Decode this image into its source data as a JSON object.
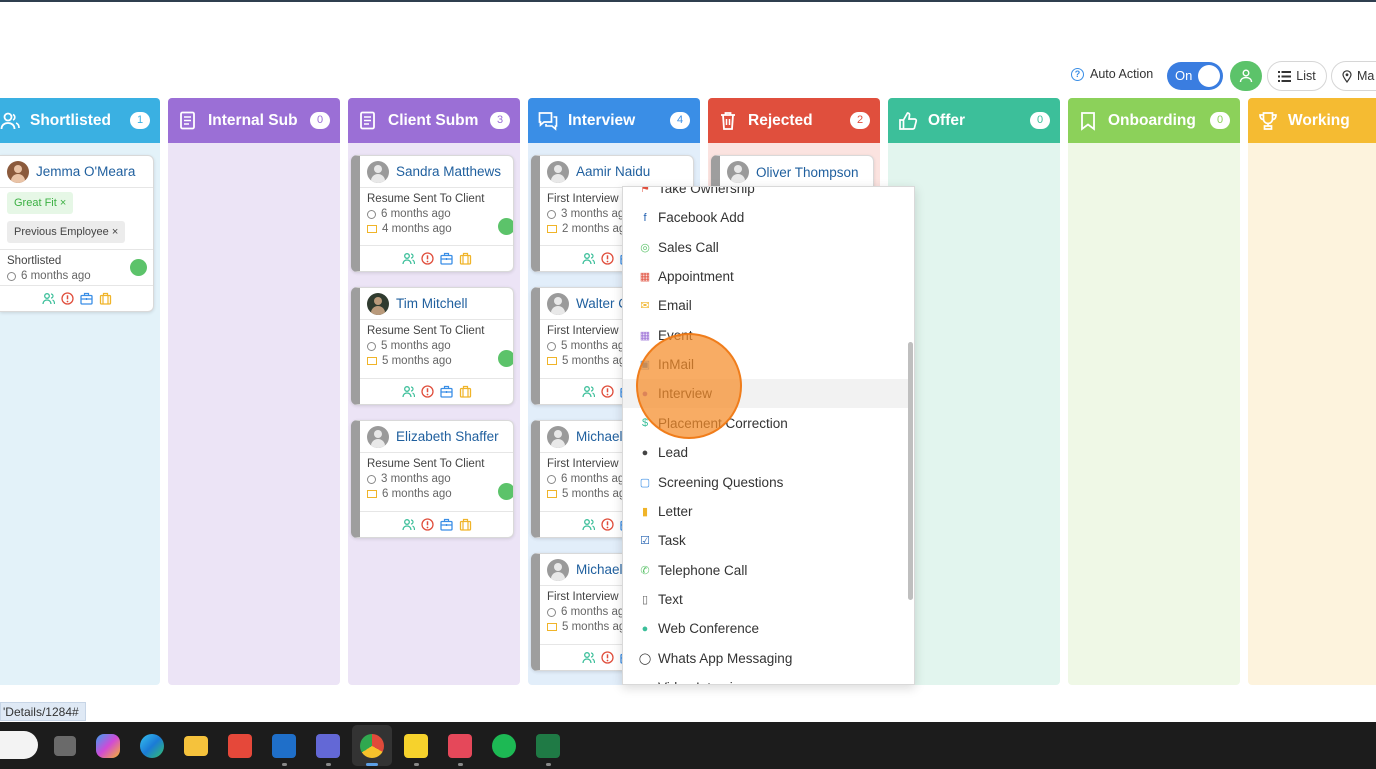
{
  "toolbar": {
    "auto_action_label": "Auto Action",
    "toggle_label": "On",
    "list_label": "List",
    "map_label": "Ma"
  },
  "columns": [
    {
      "title": "Shortlisted",
      "count": "1",
      "color": "#3ab0e2",
      "bg": "#e3f2f9",
      "icon": "users-icon"
    },
    {
      "title": "Internal Sub",
      "count": "0",
      "color": "#9b6fd6",
      "bg": "#ece4f6",
      "icon": "document-icon"
    },
    {
      "title": "Client Subm",
      "count": "3",
      "color": "#9b6fd6",
      "bg": "#ece4f6",
      "icon": "document-icon"
    },
    {
      "title": "Interview",
      "count": "4",
      "color": "#3a8ee6",
      "bg": "#e2eefa",
      "icon": "chat-icon"
    },
    {
      "title": "Rejected",
      "count": "2",
      "color": "#e04f3d",
      "bg": "#fbe3e0",
      "icon": "trash-icon"
    },
    {
      "title": "Offer",
      "count": "0",
      "color": "#3cbf9a",
      "bg": "#e2f5ee",
      "icon": "thumbs-up-icon"
    },
    {
      "title": "Onboarding",
      "count": "0",
      "color": "#8cd15a",
      "bg": "#eff8e6",
      "icon": "bookmark-icon"
    },
    {
      "title": "Working",
      "count": "",
      "color": "#f5bb32",
      "bg": "#fdf3dd",
      "icon": "trophy-icon"
    }
  ],
  "cards": {
    "jemma": {
      "name": "Jemma O'Meara",
      "tag1": "Great Fit",
      "tag2": "Previous Employee",
      "status": "Shortlisted",
      "time1": "6 months ago"
    },
    "sandra": {
      "name": "Sandra Matthews",
      "status": "Resume Sent To Client",
      "time1": "6 months ago",
      "time2": "4 months ago"
    },
    "tim": {
      "name": "Tim Mitchell",
      "status": "Resume Sent To Client",
      "time1": "5 months ago",
      "time2": "5 months ago"
    },
    "elizabeth": {
      "name": "Elizabeth Shaffer",
      "status": "Resume Sent To Client",
      "time1": "3 months ago",
      "time2": "6 months ago"
    },
    "aamir": {
      "name": "Aamir Naidu",
      "status": "First Interview",
      "time1": "3 months ago",
      "time2": "2 months ago"
    },
    "walter": {
      "name": "Walter C",
      "status": "First Interview",
      "time1": "5 months ago",
      "time2": "5 months ago"
    },
    "michael1": {
      "name": "Michael",
      "status": "First Interview",
      "time1": "6 months ago",
      "time2": "5 months ago"
    },
    "michael2": {
      "name": "Michael",
      "status": "First Interview",
      "time1": "6 months ago",
      "time2": "5 months ago"
    },
    "oliver": {
      "name": "Oliver Thompson"
    }
  },
  "dropdown": {
    "items": [
      {
        "label": "Take Ownership",
        "icon": "flag-icon",
        "color": "#e04f3d"
      },
      {
        "label": "Facebook Add",
        "icon": "facebook-icon",
        "color": "#1f5fb0"
      },
      {
        "label": "Sales Call",
        "icon": "target-icon",
        "color": "#5cc36a"
      },
      {
        "label": "Appointment",
        "icon": "calendar-icon",
        "color": "#e04f3d"
      },
      {
        "label": "Email",
        "icon": "envelope-icon",
        "color": "#f0b429"
      },
      {
        "label": "Event",
        "icon": "calendar-icon",
        "color": "#9b6fd6"
      },
      {
        "label": "InMail",
        "icon": "linkedin-icon",
        "color": "#3a8ee6"
      },
      {
        "label": "Interview",
        "icon": "chat-icon",
        "color": "#9b6fd6"
      },
      {
        "label": "Placement Correction",
        "icon": "dollar-icon",
        "color": "#3cbf9a"
      },
      {
        "label": "Lead",
        "icon": "person-icon",
        "color": "#444444"
      },
      {
        "label": "Screening Questions",
        "icon": "question-icon",
        "color": "#3a8ee6"
      },
      {
        "label": "Letter",
        "icon": "file-icon",
        "color": "#f0b429"
      },
      {
        "label": "Task",
        "icon": "checkbox-icon",
        "color": "#1f5fb0"
      },
      {
        "label": "Telephone Call",
        "icon": "phone-icon",
        "color": "#5cc36a"
      },
      {
        "label": "Text",
        "icon": "mobile-icon",
        "color": "#666666"
      },
      {
        "label": "Web Conference",
        "icon": "group-icon",
        "color": "#3cbf9a"
      },
      {
        "label": "Whats App Messaging",
        "icon": "whatsapp-icon",
        "color": "#333333"
      },
      {
        "label": "Video Interview",
        "icon": "video-icon",
        "color": "#9b6fd6"
      }
    ]
  },
  "status_url": "'Details/1284#"
}
